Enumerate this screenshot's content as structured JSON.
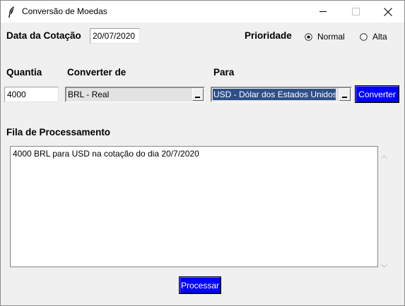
{
  "window": {
    "title": "Conversão de Moedas"
  },
  "form": {
    "date_label": "Data da Cotação",
    "date_value": "20/07/2020",
    "priority_label": "Prioridade",
    "priority_options": [
      "Normal",
      "Alta"
    ],
    "priority_selected": "Normal",
    "quantity_label": "Quantia",
    "quantity_value": "4000",
    "from_label": "Converter de",
    "from_value": "BRL - Real",
    "to_label": "Para",
    "to_value": "USD - Dólar dos Estados Unidos",
    "convert_button": "Converter"
  },
  "queue": {
    "label": "Fila de Processamento",
    "items": [
      "4000 BRL para USD na cotação do dia 20/7/2020"
    ],
    "process_button": "Processar"
  },
  "colors": {
    "button_bg": "#0000ff",
    "selection_bg": "#2c4f88",
    "window_bg": "#f0f0f0"
  },
  "icons": {
    "app": "feather-icon",
    "minimize": "minimize-icon",
    "maximize": "maximize-icon",
    "close": "close-icon"
  }
}
